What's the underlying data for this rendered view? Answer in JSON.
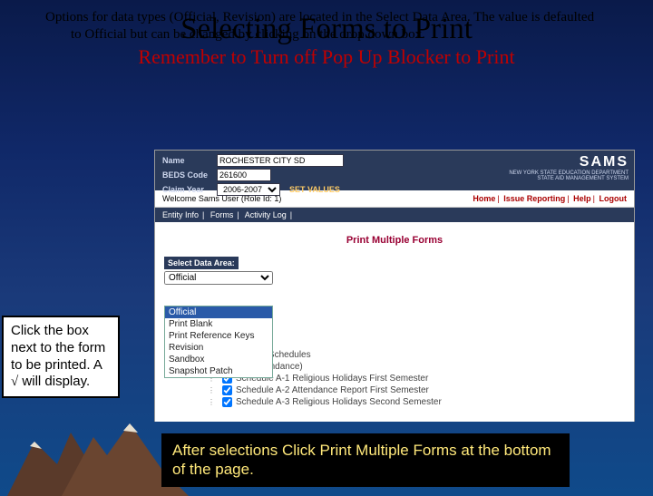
{
  "title": "Selecting Forms to Print",
  "options_text": "Options for data types (Official, Revision) are located in the Select Data Area. The value is defaulted to Official but can be changed by clicking on the drop down box.",
  "remember_text": "Remember to Turn off Pop Up Blocker to Print",
  "callout_left_prefix": "Click the box next to the form to be printed.  A ",
  "callout_left_check": "√",
  "callout_left_suffix": " will display.",
  "callout_bottom": "After selections Click Print Multiple Forms at the bottom of the page.",
  "app": {
    "labels": {
      "name": "Name",
      "beds": "BEDS Code",
      "claim_year": "Claim Year"
    },
    "name_value": "ROCHESTER CITY SD",
    "beds_value": "261600",
    "claim_year_value": "2006-2007",
    "set_values": "SET VALUES",
    "logo_title": "SAMS",
    "logo_sub1": "NEW YORK STATE EDUCATION DEPARTMENT",
    "logo_sub2": "STATE AID MANAGEMENT SYSTEM",
    "welcome": "Welcome Sams User (Role Id: 1)",
    "nav": {
      "home": "Home",
      "issue": "Issue Reporting",
      "help": "Help",
      "logout": "Logout"
    },
    "tabs": {
      "entity": "Entity Info",
      "forms": "Forms",
      "activity": "Activity Log"
    },
    "form_title": "Print Multiple Forms",
    "select_area_label": "Select Data Area:",
    "select_value": "Official",
    "dropdown": {
      "opt0": "Official",
      "opt1": "Print Blank",
      "opt2": "Print Reference Keys",
      "opt3": "Revision",
      "opt4": "Sandbox",
      "opt5": "Snapshot Patch"
    },
    "forms": {
      "f0": "Form A and Schedules",
      "f1": "Form A (Attendance)",
      "f2": "Schedule A-1 Religious Holidays First Semester",
      "f3": "Schedule A-2 Attendance Report First Semester",
      "f4": "Schedule A-3 Religious Holidays Second Semester"
    }
  }
}
